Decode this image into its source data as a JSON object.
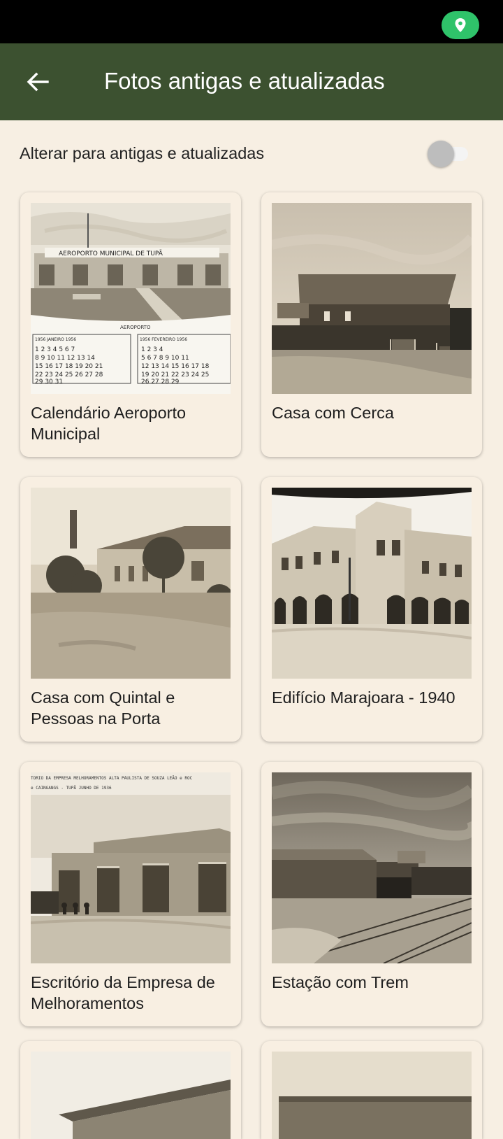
{
  "app_bar": {
    "title": "Fotos antigas e atualizadas",
    "back_icon": "arrow-left-icon",
    "background_color": "#3c5130"
  },
  "status_bar": {
    "location_icon": "location-pin-icon",
    "pill_color": "#2fc36a"
  },
  "toggle": {
    "label": "Alterar para antigas e atualizadas",
    "state": "off"
  },
  "photos": [
    {
      "caption": "Calendário Aeroporto Municipal"
    },
    {
      "caption": "Casa com Cerca"
    },
    {
      "caption": "Casa com Quintal e Pessoas na Porta"
    },
    {
      "caption": "Edifício Marajoara - 1940"
    },
    {
      "caption": "Escritório da Empresa de Melhoramentos"
    },
    {
      "caption": "Estação com Trem"
    }
  ],
  "photo_texts": {
    "aeroporto_sign": "AEROPORTO MUNICIPAL DE TUPÃ",
    "aeroporto_label": "AEROPORTO",
    "jan_header": "1956 JANEIRO 1956",
    "feb_header": "1956 FEVEREIRO 1956",
    "escritorio_caption_line1": "TORIO DA EMPRESA MELHORAMENTOS ALTA PAULISTA DE SOUZA LEÃO e ROC",
    "escritorio_caption_line2": "e CAINGANGS - TUPÃ JUNHO DE 1936"
  }
}
